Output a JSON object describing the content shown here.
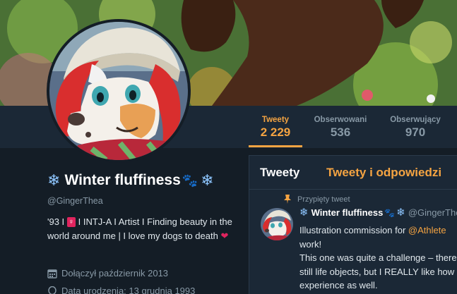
{
  "profile": {
    "name": "Winter fluffiness",
    "handle": "@GingerThea",
    "bio": {
      "part1": "'93 I ",
      "venus": "♀",
      "part2": " I INTJ-A I Artist I Finding beauty in the world around me | I love my dogs to death ",
      "heart": "❤"
    },
    "joined": "Dołączył październik 2013",
    "birthdate": "Data urodzenia: 13 grudnia 1993"
  },
  "nav": {
    "items": [
      {
        "label": "Tweety",
        "value": "2 229",
        "active": true
      },
      {
        "label": "Obserwowani",
        "value": "536",
        "active": false
      },
      {
        "label": "Obserwujący",
        "value": "970",
        "active": false
      }
    ]
  },
  "timeline": {
    "tabs": [
      "Tweety",
      "Tweety i odpowiedzi"
    ],
    "pinned_label": "Przypięty tweet",
    "tweet": {
      "name": "Winter fluffiness",
      "handle": "@GingerThea",
      "line1_prefix": "Illustration commission for ",
      "line1_link": "@Athlete",
      "line2": "work!",
      "line3": "This one was quite a challenge – there",
      "line4": "still life objects, but I REALLY like how",
      "line5": "experience as well."
    }
  },
  "icons": {
    "snowflake": "❄",
    "paws": "🐾",
    "calendar": "calendar-icon",
    "balloon": "balloon-icon",
    "pin": "pin-icon"
  },
  "colors": {
    "accent": "#f5a442",
    "background": "#141d26",
    "panel": "#1b2836",
    "muted": "#8899a6"
  }
}
